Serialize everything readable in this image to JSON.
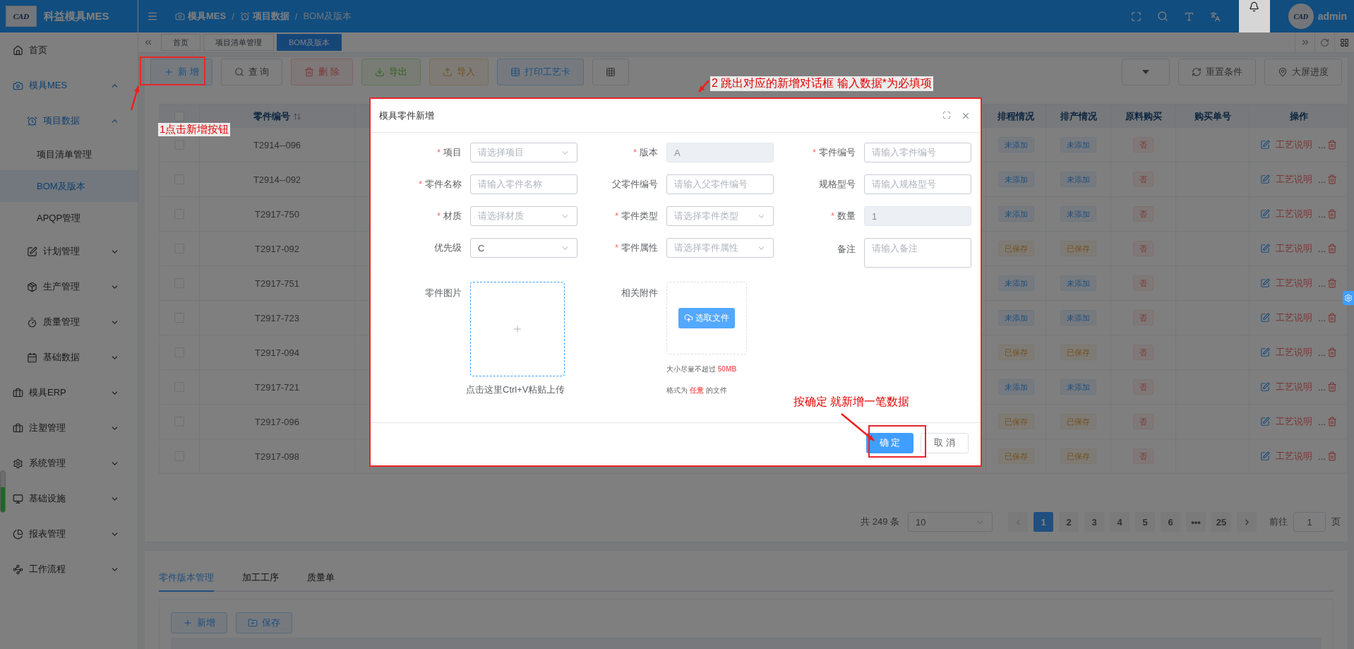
{
  "app": {
    "logo_text": "CAD",
    "title": "科益模具MES"
  },
  "breadcrumb": {
    "separator": "/",
    "items": [
      {
        "label": "模具MES",
        "current": false
      },
      {
        "label": "项目数据",
        "current": false
      },
      {
        "label": "BOM及版本",
        "current": true
      }
    ]
  },
  "user": {
    "avatar_text": "CAD",
    "name": "admin"
  },
  "sidebar": {
    "items": [
      {
        "label": "首页",
        "selected": false
      },
      {
        "label": "模具MES",
        "selected": false,
        "expanded": true,
        "children": [
          {
            "label": "项目数据",
            "selected": false,
            "expanded": true,
            "children": [
              {
                "label": "项目清单管理",
                "selected": false
              },
              {
                "label": "BOM及版本",
                "selected": true
              },
              {
                "label": "APQP管理",
                "selected": false
              }
            ]
          },
          {
            "label": "计划管理",
            "selected": false,
            "expanded": false
          },
          {
            "label": "生产管理",
            "selected": false,
            "expanded": false
          },
          {
            "label": "质量管理",
            "selected": false,
            "expanded": false
          },
          {
            "label": "基础数据",
            "selected": false,
            "expanded": false
          }
        ]
      },
      {
        "label": "模具ERP",
        "selected": false,
        "expanded": false
      },
      {
        "label": "注塑管理",
        "selected": false,
        "expanded": false
      },
      {
        "label": "系统管理",
        "selected": false,
        "expanded": false
      },
      {
        "label": "基础设施",
        "selected": false,
        "expanded": false
      },
      {
        "label": "报表管理",
        "selected": false,
        "expanded": false
      },
      {
        "label": "工作流程",
        "selected": false,
        "expanded": false
      }
    ]
  },
  "page_tabs": [
    {
      "label": "首页",
      "selected": false
    },
    {
      "label": "项目清单管理",
      "selected": false
    },
    {
      "label": "BOM及版本",
      "selected": true
    }
  ],
  "toolbar": {
    "left": [
      {
        "label": "新 增",
        "kind": "primary"
      },
      {
        "label": "查 询",
        "kind": "default"
      },
      {
        "label": "删 除",
        "kind": "danger"
      },
      {
        "label": "导出",
        "kind": "success"
      },
      {
        "label": "导入",
        "kind": "warning"
      },
      {
        "label": "打印工艺卡",
        "kind": "primary"
      },
      {
        "kind": "default"
      }
    ],
    "right": [
      {
        "kind": "default"
      },
      {
        "label": "重置条件",
        "kind": "default"
      },
      {
        "label": "大屏进度",
        "kind": "default"
      }
    ]
  },
  "table": {
    "all_checked": false,
    "columns": [
      {
        "label": "零件编号",
        "sortable": true
      },
      {
        "label": "排程情况",
        "sortable": false
      },
      {
        "label": "排产情况",
        "sortable": false
      },
      {
        "label": "原料购买",
        "sortable": false
      },
      {
        "label": "购买单号",
        "sortable": false
      },
      {
        "label": "操作",
        "sortable": false
      }
    ],
    "rows": [
      {
        "checked": false,
        "part_no": "T2914--096",
        "schedule": {
          "text": "未添加",
          "kind": "primary"
        },
        "production": {
          "text": "未添加",
          "kind": "primary"
        },
        "material": {
          "text": "否",
          "kind": "danger"
        },
        "action": "工艺说明",
        "more": "..."
      },
      {
        "checked": false,
        "part_no": "T2914--092",
        "schedule": {
          "text": "未添加",
          "kind": "primary"
        },
        "production": {
          "text": "未添加",
          "kind": "primary"
        },
        "material": {
          "text": "否",
          "kind": "danger"
        },
        "action": "工艺说明",
        "more": "..."
      },
      {
        "checked": false,
        "part_no": "T2917-750",
        "schedule": {
          "text": "未添加",
          "kind": "primary"
        },
        "production": {
          "text": "未添加",
          "kind": "primary"
        },
        "material": {
          "text": "否",
          "kind": "danger"
        },
        "action": "工艺说明",
        "more": "..."
      },
      {
        "checked": false,
        "part_no": "T2917-092",
        "schedule": {
          "text": "已保存",
          "kind": "warning"
        },
        "production": {
          "text": "已保存",
          "kind": "warning"
        },
        "material": {
          "text": "否",
          "kind": "danger"
        },
        "action": "工艺说明",
        "more": "..."
      },
      {
        "checked": false,
        "part_no": "T2917-751",
        "schedule": {
          "text": "未添加",
          "kind": "primary"
        },
        "production": {
          "text": "未添加",
          "kind": "primary"
        },
        "material": {
          "text": "否",
          "kind": "danger"
        },
        "action": "工艺说明",
        "more": "..."
      },
      {
        "checked": false,
        "part_no": "T2917-723",
        "schedule": {
          "text": "未添加",
          "kind": "primary"
        },
        "production": {
          "text": "未添加",
          "kind": "primary"
        },
        "material": {
          "text": "否",
          "kind": "danger"
        },
        "action": "工艺说明",
        "more": "..."
      },
      {
        "checked": false,
        "part_no": "T2917-094",
        "schedule": {
          "text": "已保存",
          "kind": "warning"
        },
        "production": {
          "text": "已保存",
          "kind": "warning"
        },
        "material": {
          "text": "否",
          "kind": "danger"
        },
        "action": "工艺说明",
        "more": "..."
      },
      {
        "checked": false,
        "part_no": "T2917-721",
        "schedule": {
          "text": "未添加",
          "kind": "primary"
        },
        "production": {
          "text": "未添加",
          "kind": "primary"
        },
        "material": {
          "text": "否",
          "kind": "danger"
        },
        "action": "工艺说明",
        "more": "..."
      },
      {
        "checked": false,
        "part_no": "T2917-096",
        "schedule": {
          "text": "已保存",
          "kind": "warning"
        },
        "production": {
          "text": "已保存",
          "kind": "warning"
        },
        "material": {
          "text": "否",
          "kind": "danger"
        },
        "action": "工艺说明",
        "more": "..."
      },
      {
        "checked": false,
        "part_no": "T2917-098",
        "schedule": {
          "text": "已保存",
          "kind": "warning"
        },
        "production": {
          "text": "已保存",
          "kind": "warning"
        },
        "material": {
          "text": "否",
          "kind": "danger"
        },
        "action": "工艺说明",
        "more": "..."
      }
    ]
  },
  "pagination": {
    "total": "共 249 条",
    "page_size": "10",
    "pages": [
      {
        "label": "1",
        "selected": true
      },
      {
        "label": "2",
        "selected": false
      },
      {
        "label": "3",
        "selected": false
      },
      {
        "label": "4",
        "selected": false
      },
      {
        "label": "5",
        "selected": false
      },
      {
        "label": "6",
        "selected": false
      },
      {
        "label": "•••",
        "selected": false
      },
      {
        "label": "25",
        "selected": false
      }
    ],
    "goto_label": "前往",
    "goto_value": "1",
    "page_unit": "页"
  },
  "detail_panel": {
    "tabs": [
      {
        "label": "零件版本管理",
        "selected": true
      },
      {
        "label": "加工工序",
        "selected": false
      },
      {
        "label": "质量单",
        "selected": false
      }
    ],
    "buttons": [
      {
        "label": "新增"
      },
      {
        "label": "保存"
      }
    ]
  },
  "dialog": {
    "title": "模具零件新增",
    "required_mark": "*",
    "fields": [
      {
        "label": "项目",
        "required": true,
        "kind": "select",
        "placeholder": "请选择项目",
        "disabled": false
      },
      {
        "label": "版本",
        "required": true,
        "kind": "input",
        "value": "A",
        "disabled": true
      },
      {
        "label": "零件编号",
        "required": true,
        "kind": "input",
        "placeholder": "请输入零件编号",
        "disabled": false
      },
      {
        "label": "零件名称",
        "required": true,
        "kind": "input",
        "placeholder": "请输入零件名称",
        "disabled": false
      },
      {
        "label": "父零件编号",
        "required": false,
        "kind": "input",
        "placeholder": "请输入父零件编号",
        "disabled": false
      },
      {
        "label": "规格型号",
        "required": false,
        "kind": "input",
        "placeholder": "请输入规格型号",
        "disabled": false
      },
      {
        "label": "材质",
        "required": true,
        "kind": "select",
        "placeholder": "请选择材质",
        "disabled": false
      },
      {
        "label": "零件类型",
        "required": true,
        "kind": "select",
        "placeholder": "请选择零件类型",
        "disabled": false
      },
      {
        "label": "数量",
        "required": true,
        "kind": "input",
        "value": "1",
        "disabled": true
      },
      {
        "label": "优先级",
        "required": false,
        "kind": "select",
        "value": "C",
        "disabled": false
      },
      {
        "label": "零件属性",
        "required": true,
        "kind": "select",
        "placeholder": "请选择零件属性",
        "disabled": false
      },
      {
        "label": "备注",
        "required": false,
        "kind": "textarea",
        "placeholder": "请输入备注",
        "disabled": false
      }
    ],
    "image_upload": {
      "label": "零件图片",
      "hint": "点击这里Ctrl+V粘贴上传"
    },
    "attachment": {
      "label": "相关附件",
      "button": "选取文件",
      "size_hint": "大小尽量不超过 **50MB**",
      "format_hint": "格式为 **任意** 的文件"
    },
    "buttons": [
      {
        "label": "确 定",
        "kind": "primary"
      },
      {
        "label": "取 消",
        "kind": "default"
      }
    ]
  },
  "annotations": [
    "1点击新增按钮",
    "2 跳出对应的新增对话框 输入数据*为必填项",
    "按确定 就新增一笔数据"
  ]
}
